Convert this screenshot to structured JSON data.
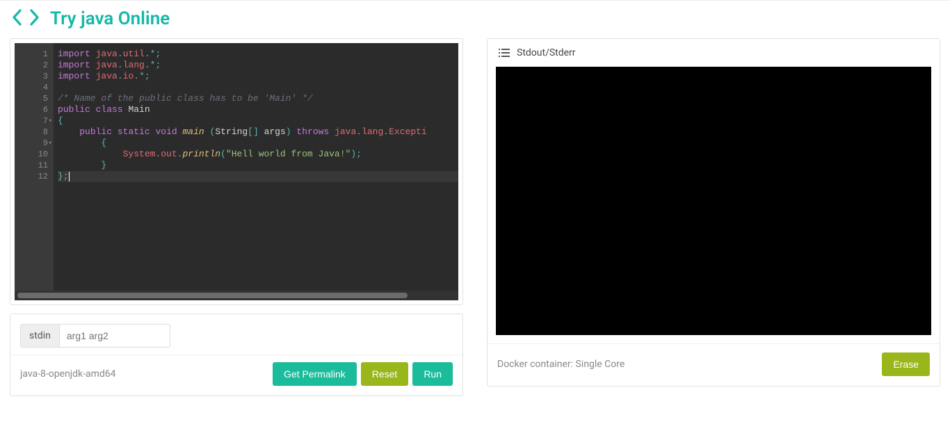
{
  "header": {
    "title": "Try java Online"
  },
  "editor": {
    "lines": [
      {
        "n": "1",
        "html": "<span class='tok-kw'>import</span> <span class='tok-id'>java</span><span class='tok-op'>.</span><span class='tok-id'>util</span><span class='tok-op'>.*;</span>"
      },
      {
        "n": "2",
        "html": "<span class='tok-kw'>import</span> <span class='tok-id'>java</span><span class='tok-op'>.</span><span class='tok-id'>lang</span><span class='tok-op'>.*;</span>"
      },
      {
        "n": "3",
        "html": "<span class='tok-kw'>import</span> <span class='tok-id'>java</span><span class='tok-op'>.</span><span class='tok-id'>io</span><span class='tok-op'>.*;</span>"
      },
      {
        "n": "4",
        "html": ""
      },
      {
        "n": "5",
        "html": "<span class='tok-cmt'>/* Name of the public class has to be 'Main' */</span>"
      },
      {
        "n": "6",
        "html": "<span class='tok-kw'>public</span> <span class='tok-kw'>class</span> <span class='tok-plain'>Main</span>"
      },
      {
        "n": "7",
        "fold": true,
        "html": "<span class='tok-op'>{</span>"
      },
      {
        "n": "8",
        "html": "    <span class='tok-kw'>public</span> <span class='tok-kw'>static</span> <span class='tok-kw'>void</span> <span class='tok-func'>main</span> <span class='tok-op'>(</span><span class='tok-plain'>String</span><span class='tok-op'>[]</span> <span class='tok-plain'>args</span><span class='tok-op'>)</span> <span class='tok-kw'>throws</span> <span class='tok-id'>java</span><span class='tok-op'>.</span><span class='tok-id'>lang</span><span class='tok-op'>.</span><span class='tok-id'>Excepti</span>"
      },
      {
        "n": "9",
        "fold": true,
        "html": "        <span class='tok-op'>{</span>"
      },
      {
        "n": "10",
        "html": "            <span class='tok-id'>System</span><span class='tok-op'>.</span><span class='tok-id'>out</span><span class='tok-op'>.</span><span class='tok-func'>println</span><span class='tok-op'>(</span><span class='tok-str'>\"Hell world from Java!\"</span><span class='tok-op'>);</span>"
      },
      {
        "n": "11",
        "html": "        <span class='tok-op'>}</span>"
      },
      {
        "n": "12",
        "active": true,
        "html": "<span class='tok-op'>};</span><span class='cursor'></span>"
      }
    ]
  },
  "stdin": {
    "label": "stdin",
    "placeholder": "arg1 arg2",
    "value": ""
  },
  "footer_left": {
    "jdk": "java-8-openjdk-amd64",
    "permalink": "Get Permalink",
    "reset": "Reset",
    "run": "Run"
  },
  "output": {
    "header": "Stdout/Stderr",
    "docker": "Docker container: Single Core",
    "erase": "Erase"
  }
}
